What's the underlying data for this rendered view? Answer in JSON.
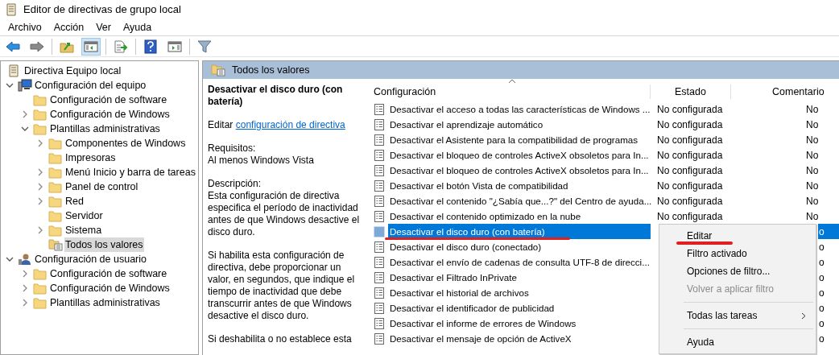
{
  "window": {
    "title": "Editor de directivas de grupo local"
  },
  "menu_bar": [
    "Archivo",
    "Acción",
    "Ver",
    "Ayuda"
  ],
  "toolbar": [
    {
      "kind": "back",
      "pressed": false
    },
    {
      "kind": "forward",
      "pressed": false
    },
    {
      "kind": "sep"
    },
    {
      "kind": "up",
      "pressed": false
    },
    {
      "kind": "tree",
      "pressed": true
    },
    {
      "kind": "sep"
    },
    {
      "kind": "export",
      "pressed": false
    },
    {
      "kind": "sep"
    },
    {
      "kind": "help",
      "pressed": false
    },
    {
      "kind": "pane",
      "pressed": false
    },
    {
      "kind": "sep"
    },
    {
      "kind": "filter",
      "pressed": false
    }
  ],
  "tree": [
    {
      "label": "Directiva Equipo local",
      "kind": "policy",
      "selected": false,
      "children": [
        {
          "label": "Configuración del equipo",
          "kind": "computer",
          "expanded": true,
          "selected": false,
          "children": [
            {
              "label": "Configuración de software",
              "kind": "folder",
              "selected": false
            },
            {
              "label": "Configuración de Windows",
              "kind": "folder",
              "expanded": false,
              "selected": false
            },
            {
              "label": "Plantillas administrativas",
              "kind": "folder",
              "expanded": true,
              "selected": false,
              "children": [
                {
                  "label": "Componentes de Windows",
                  "kind": "folder",
                  "expanded": false,
                  "selected": false
                },
                {
                  "label": "Impresoras",
                  "kind": "folder",
                  "selected": false
                },
                {
                  "label": "Menú Inicio y barra de tareas",
                  "kind": "folder",
                  "expanded": false,
                  "selected": false
                },
                {
                  "label": "Panel de control",
                  "kind": "folder",
                  "expanded": false,
                  "selected": false
                },
                {
                  "label": "Red",
                  "kind": "folder",
                  "expanded": false,
                  "selected": false
                },
                {
                  "label": "Servidor",
                  "kind": "folder",
                  "selected": false
                },
                {
                  "label": "Sistema",
                  "kind": "folder",
                  "expanded": false,
                  "selected": false
                },
                {
                  "label": "Todos los valores",
                  "kind": "all",
                  "selected": true
                }
              ]
            }
          ]
        },
        {
          "label": "Configuración de usuario",
          "kind": "user",
          "expanded": true,
          "selected": false,
          "children": [
            {
              "label": "Configuración de software",
              "kind": "folder",
              "expanded": false,
              "selected": false
            },
            {
              "label": "Configuración de Windows",
              "kind": "folder",
              "expanded": false,
              "selected": false
            },
            {
              "label": "Plantillas administrativas",
              "kind": "folder",
              "expanded": false,
              "selected": false
            }
          ]
        }
      ]
    }
  ],
  "details": {
    "header": "Todos los valores",
    "title": "Desactivar el disco duro (con batería)",
    "edit_prefix": "Editar",
    "edit_link": "configuración de directiva",
    "requirements_label": "Requisitos:",
    "requirements": "Al menos Windows Vista",
    "description_label": "Descripción:",
    "paragraphs": [
      "Esta configuración de directiva especifica el período de inactividad antes de que Windows desactive el disco duro.",
      "Si habilita esta configuración de directiva, debe proporcionar un valor, en segundos, que indique el tiempo de inactividad que debe transcurrir antes de que Windows desactive el disco duro.",
      "Si deshabilita o no establece esta"
    ]
  },
  "table": {
    "columns": [
      "Configuración",
      "Estado",
      "Comentario"
    ],
    "rows": [
      {
        "setting": "Desactivar el acceso a todas las características de Windows ...",
        "state": "No configurada",
        "comment": "No",
        "selected": false
      },
      {
        "setting": "Desactivar el aprendizaje automático",
        "state": "No configurada",
        "comment": "No",
        "selected": false
      },
      {
        "setting": "Desactivar el Asistente para la compatibilidad de programas",
        "state": "No configurada",
        "comment": "No",
        "selected": false
      },
      {
        "setting": "Desactivar el bloqueo de controles ActiveX obsoletos para In...",
        "state": "No configurada",
        "comment": "No",
        "selected": false
      },
      {
        "setting": "Desactivar el bloqueo de controles ActiveX obsoletos para In...",
        "state": "No configurada",
        "comment": "No",
        "selected": false
      },
      {
        "setting": "Desactivar el botón Vista de compatibilidad",
        "state": "No configurada",
        "comment": "No",
        "selected": false
      },
      {
        "setting": "Desactivar el contenido \"¿Sabía que...?\" del Centro de ayuda...",
        "state": "No configurada",
        "comment": "No",
        "selected": false
      },
      {
        "setting": "Desactivar el contenido optimizado en la nube",
        "state": "No configurada",
        "comment": "No",
        "selected": false
      },
      {
        "setting": "Desactivar el disco duro (con batería)",
        "comment": "o",
        "selected": true
      },
      {
        "setting": "Desactivar el disco duro (conectado)",
        "comment": "o",
        "selected": false
      },
      {
        "setting": "Desactivar el envío de cadenas de consulta UTF-8 de direcci...",
        "comment": "o",
        "selected": false
      },
      {
        "setting": "Desactivar el Filtrado InPrivate",
        "comment": "o",
        "selected": false
      },
      {
        "setting": "Desactivar el historial de archivos",
        "comment": "o",
        "selected": false
      },
      {
        "setting": "Desactivar el identificador de publicidad",
        "comment": "o",
        "selected": false
      },
      {
        "setting": "Desactivar el informe de errores de Windows",
        "comment": "o",
        "selected": false
      },
      {
        "setting": "Desactivar el mensaje de opción de ActiveX",
        "comment": "o",
        "selected": false
      }
    ]
  },
  "context_menu": {
    "items": [
      {
        "kind": "item",
        "label": "Editar",
        "disabled": false
      },
      {
        "kind": "item",
        "label": "Filtro activado",
        "disabled": false
      },
      {
        "kind": "item",
        "label": "Opciones de filtro...",
        "disabled": false
      },
      {
        "kind": "item",
        "label": "Volver a aplicar filtro",
        "disabled": true
      },
      {
        "kind": "separator"
      },
      {
        "kind": "submenu",
        "label": "Todas las tareas",
        "disabled": false
      },
      {
        "kind": "separator"
      },
      {
        "kind": "item",
        "label": "Ayuda",
        "disabled": false
      }
    ]
  }
}
